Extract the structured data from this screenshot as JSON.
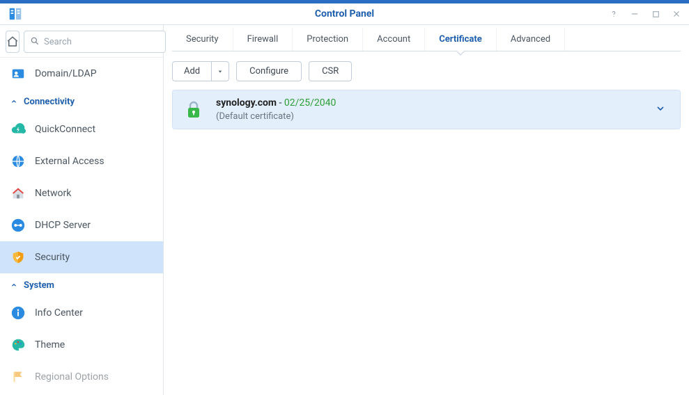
{
  "window": {
    "title": "Control Panel"
  },
  "search": {
    "placeholder": "Search"
  },
  "sidebar": {
    "itemBefore": {
      "label": "Domain/LDAP"
    },
    "groups": [
      {
        "name": "Connectivity",
        "items": [
          {
            "id": "quickconnect",
            "label": "QuickConnect"
          },
          {
            "id": "external-access",
            "label": "External Access"
          },
          {
            "id": "network",
            "label": "Network"
          },
          {
            "id": "dhcp-server",
            "label": "DHCP Server"
          },
          {
            "id": "security",
            "label": "Security",
            "selected": true
          }
        ]
      },
      {
        "name": "System",
        "items": [
          {
            "id": "info-center",
            "label": "Info Center"
          },
          {
            "id": "theme",
            "label": "Theme"
          },
          {
            "id": "regional-options",
            "label": "Regional Options"
          }
        ]
      }
    ]
  },
  "tabs": [
    {
      "label": "Security"
    },
    {
      "label": "Firewall"
    },
    {
      "label": "Protection"
    },
    {
      "label": "Account"
    },
    {
      "label": "Certificate",
      "active": true
    },
    {
      "label": "Advanced"
    }
  ],
  "toolbar": {
    "add": "Add",
    "configure": "Configure",
    "csr": "CSR"
  },
  "certificate": {
    "domain": "synology.com",
    "expires": "02/25/2040",
    "separator": " - ",
    "subtitle": "(Default certificate)"
  }
}
